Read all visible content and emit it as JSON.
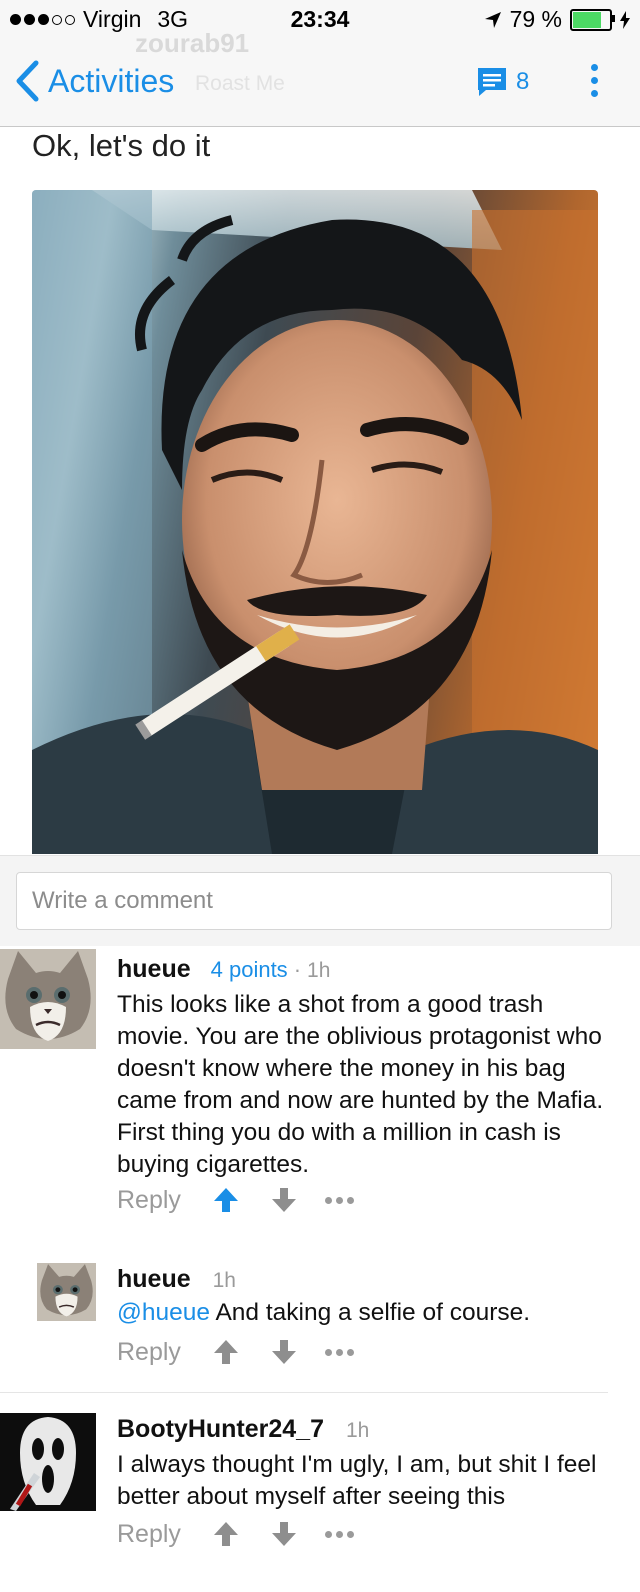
{
  "status_bar": {
    "carrier": "Virgin",
    "network": "3G",
    "time": "23:34",
    "battery_percent": "79 %",
    "battery_level": 0.79,
    "signal_bars_filled": 3,
    "signal_bars_total": 5
  },
  "nav": {
    "back_label": "Activities",
    "comment_count": "8",
    "ghost_username": "zourab91",
    "ghost_subtitle": "Roast Me",
    "accent_color": "#1a8ee6"
  },
  "post": {
    "title": "Ok, let's do it"
  },
  "comment_input": {
    "placeholder": "Write a comment"
  },
  "comments": [
    {
      "user": "hueue",
      "points": "4 points",
      "separator": "·",
      "time": "1h",
      "body": "This looks like a shot from a good trash movie. You are the oblivious protagonist who doesn't know where the money in his bag came from and now are hunted by the Mafia. First thing you do with a million in cash is buying cigarettes.",
      "reply_label": "Reply",
      "upvoted": true
    },
    {
      "user": "hueue",
      "time": "1h",
      "mention": "@hueue",
      "body": " And taking a selfie of course.",
      "reply_label": "Reply",
      "upvoted": false
    },
    {
      "user": "BootyHunter24_7",
      "time": "1h",
      "body": "I always thought I'm ugly, I am, but shit I feel better about myself after seeing this",
      "reply_label": "Reply",
      "upvoted": false
    }
  ]
}
